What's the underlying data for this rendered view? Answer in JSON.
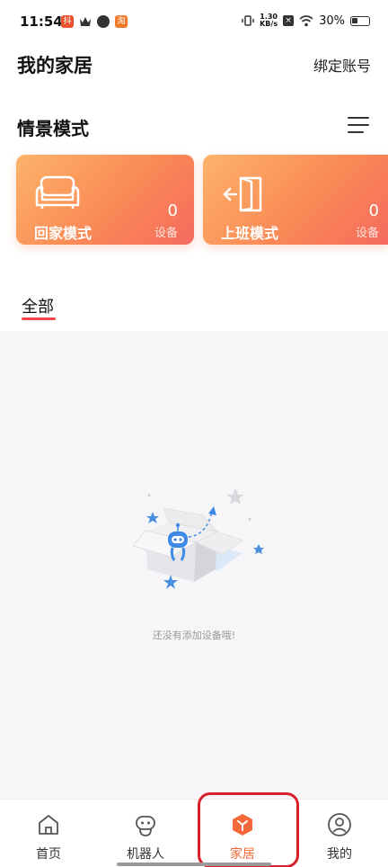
{
  "status_bar": {
    "time": "11:54",
    "net_speed_value": "1.30",
    "net_speed_unit": "KB/s",
    "battery": "30%"
  },
  "header": {
    "title": "我的家居",
    "bind_account": "绑定账号"
  },
  "scenes": {
    "title": "情景模式",
    "cards": [
      {
        "name": "回家模式",
        "count": "0",
        "unit": "设备",
        "icon": "sofa-icon"
      },
      {
        "name": "上班模式",
        "count": "0",
        "unit": "设备",
        "icon": "door-exit-icon"
      }
    ]
  },
  "tabs": {
    "all": "全部"
  },
  "empty_state": {
    "text": "还没有添加设备哦!"
  },
  "bottom_nav": {
    "items": [
      {
        "label": "首页",
        "icon": "house-icon",
        "active": false
      },
      {
        "label": "机器人",
        "icon": "robot-icon",
        "active": false
      },
      {
        "label": "家居",
        "icon": "home-hex-icon",
        "active": true
      },
      {
        "label": "我的",
        "icon": "person-icon",
        "active": false
      }
    ]
  },
  "colors": {
    "accent": "#f5683a",
    "card_gradient_start": "#fdb36a",
    "card_gradient_end": "#f56a5e",
    "tab_underline": "#f2484a",
    "highlight": "#d8202c"
  }
}
